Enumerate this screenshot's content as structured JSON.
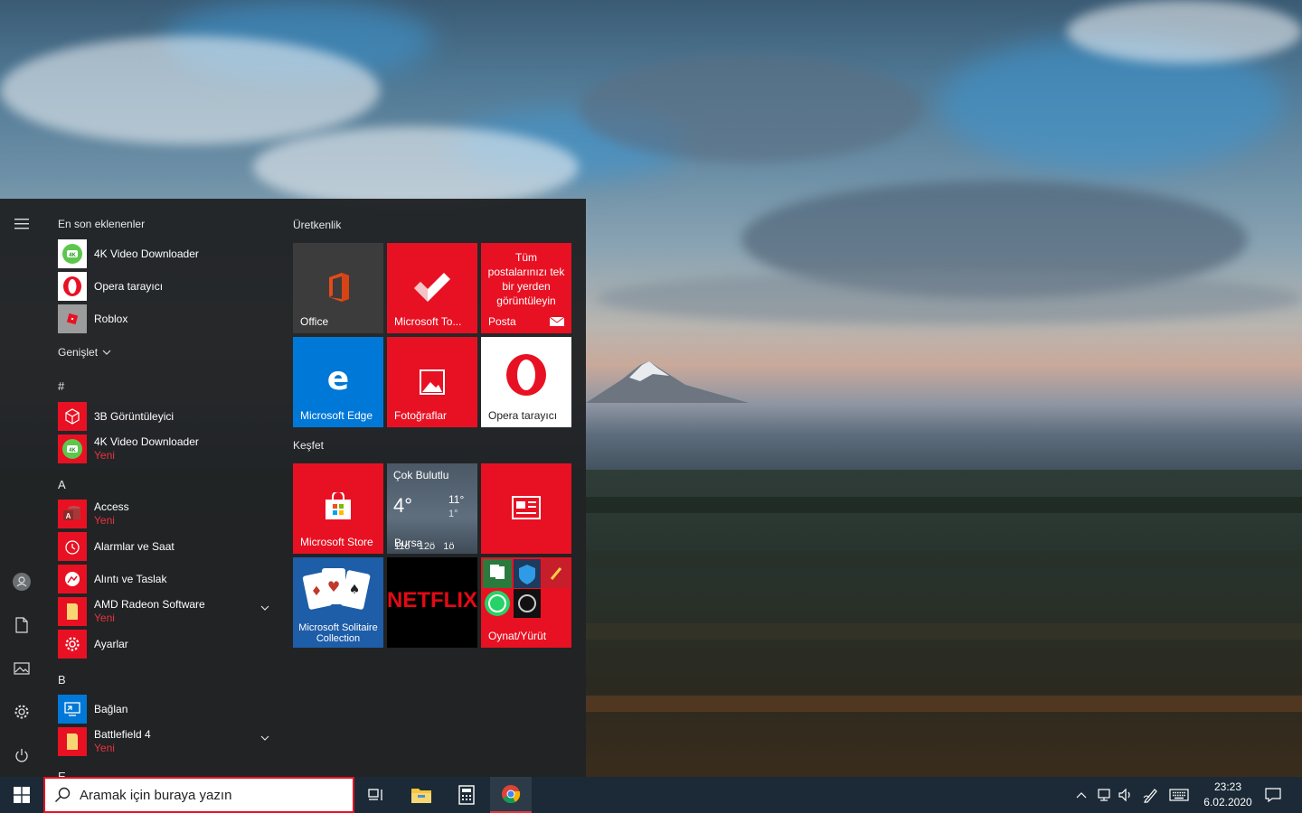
{
  "start_menu": {
    "app_list": {
      "recent_header": "En son eklenenler",
      "recent": [
        {
          "name": "4K Video Downloader"
        },
        {
          "name": "Opera tarayıcı"
        },
        {
          "name": "Roblox"
        }
      ],
      "expand_label": "Genişlet",
      "sections": [
        {
          "letter": "#",
          "apps": [
            {
              "name": "3B Görüntüleyici",
              "badge": ""
            },
            {
              "name": "4K Video Downloader",
              "badge": "Yeni"
            }
          ]
        },
        {
          "letter": "A",
          "apps": [
            {
              "name": "Access",
              "badge": "Yeni"
            },
            {
              "name": "Alarmlar ve Saat",
              "badge": ""
            },
            {
              "name": "Alıntı ve Taslak",
              "badge": ""
            },
            {
              "name": "AMD Radeon Software",
              "badge": "Yeni"
            },
            {
              "name": "Ayarlar",
              "badge": ""
            }
          ]
        },
        {
          "letter": "B",
          "apps": [
            {
              "name": "Bağlan",
              "badge": ""
            },
            {
              "name": "Battlefield 4",
              "badge": "Yeni"
            }
          ]
        },
        {
          "letter": "E",
          "apps": []
        }
      ]
    },
    "tiles": {
      "group1": "Üretkenlik",
      "group2": "Keşfet",
      "office": "Office",
      "todo": "Microsoft To...",
      "mail_message": "Tüm postalarınızı tek bir yerden görüntüleyin",
      "mail": "Posta",
      "edge": "Microsoft Edge",
      "photos": "Fotoğraflar",
      "opera": "Opera tarayıcı",
      "store": "Microsoft Store",
      "weather": {
        "condition": "Çok Bulutlu",
        "temp": "4°",
        "high": "11°",
        "low": "1°",
        "city": "Bursa",
        "row": "11ö   12ö   1ö"
      },
      "solitaire": "Microsoft Solitaire Collection",
      "netflix": "NETFLIX",
      "play": "Oynat/Yürüt"
    }
  },
  "taskbar": {
    "search_placeholder": "Aramak için buraya yazın",
    "time": "23:23",
    "date": "6.02.2020"
  },
  "colors": {
    "accent_red": "#e81123",
    "accent_blue": "#0078d7",
    "menu_bg": "#212325",
    "taskbar_bg": "#1b2a36"
  }
}
